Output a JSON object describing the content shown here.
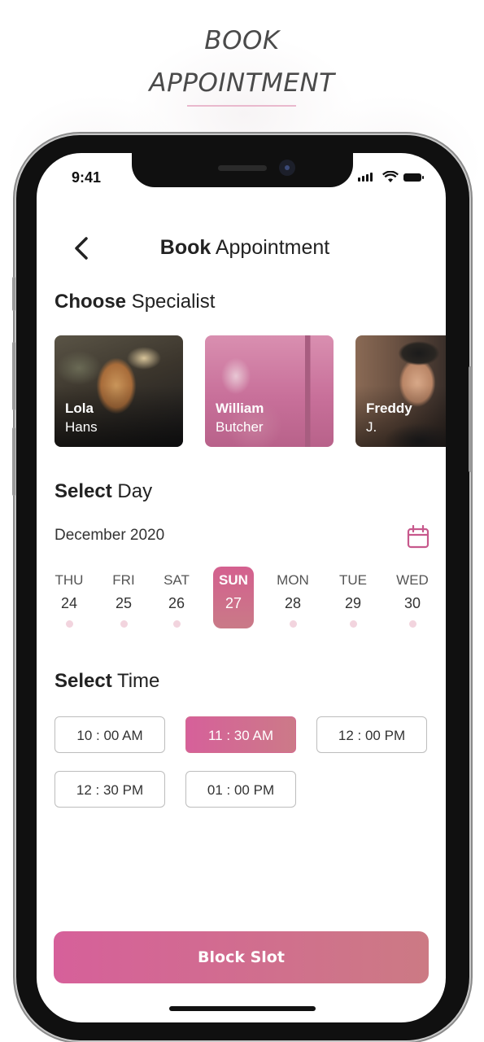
{
  "promo": {
    "line1": "BOOK",
    "line2": "APPOINTMENT"
  },
  "status": {
    "time": "9:41"
  },
  "header": {
    "title_bold": "Book",
    "title_rest": " Appointment"
  },
  "specialist_section": {
    "bold": "Choose",
    "rest": " Specialist"
  },
  "specialists": [
    {
      "first": "Lola",
      "last": "Hans"
    },
    {
      "first": "William",
      "last": "Butcher"
    },
    {
      "first": "Freddy",
      "last": "J."
    }
  ],
  "day_section": {
    "bold": "Select",
    "rest": " Day",
    "month": "December 2020"
  },
  "days": [
    {
      "name": "THU",
      "date": "24"
    },
    {
      "name": "FRI",
      "date": "25"
    },
    {
      "name": "SAT",
      "date": "26"
    },
    {
      "name": "SUN",
      "date": "27",
      "selected": true
    },
    {
      "name": "MON",
      "date": "28"
    },
    {
      "name": "TUE",
      "date": "29"
    },
    {
      "name": "WED",
      "date": "30"
    }
  ],
  "time_section": {
    "bold": "Select",
    "rest": " Time"
  },
  "times": [
    {
      "label": "10 : 00 AM"
    },
    {
      "label": "11 : 30 AM",
      "selected": true
    },
    {
      "label": "12 : 00 PM"
    },
    {
      "label": "12 : 30 PM"
    },
    {
      "label": "01 : 00 PM"
    }
  ],
  "cta": {
    "label": "Block Slot"
  },
  "colors": {
    "accent": "#d6609a",
    "accent_end": "#cc7a84"
  }
}
